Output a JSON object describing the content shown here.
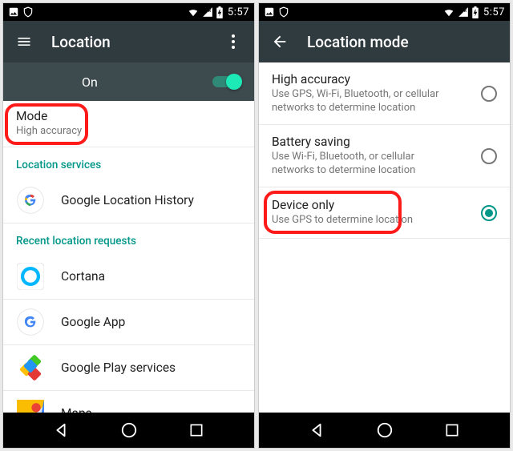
{
  "status": {
    "time": "5:57"
  },
  "left": {
    "title": "Location",
    "on_label": "On",
    "mode": {
      "title": "Mode",
      "subtitle": "High accuracy"
    },
    "section_services": "Location services",
    "services": [
      {
        "label": "Google Location History"
      }
    ],
    "section_recent": "Recent location requests",
    "recent": [
      {
        "label": "Cortana"
      },
      {
        "label": "Google App"
      },
      {
        "label": "Google Play services"
      },
      {
        "label": "Maps"
      }
    ]
  },
  "right": {
    "title": "Location mode",
    "options": [
      {
        "title": "High accuracy",
        "subtitle": "Use GPS, Wi-Fi, Bluetooth, or cellular networks to determine location",
        "selected": false
      },
      {
        "title": "Battery saving",
        "subtitle": "Use Wi-Fi, Bluetooth, or cellular networks to determine location",
        "selected": false
      },
      {
        "title": "Device only",
        "subtitle": "Use GPS to determine location",
        "selected": true
      }
    ]
  }
}
